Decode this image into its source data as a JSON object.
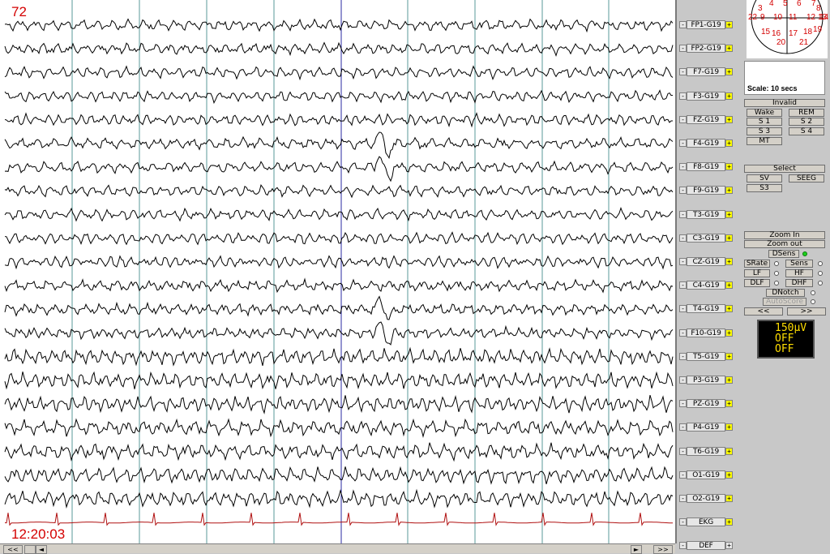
{
  "page_number": "72",
  "timestamp": "12:20:03",
  "channels": [
    {
      "label": "FP1-G19"
    },
    {
      "label": "FP2-G19"
    },
    {
      "label": "F7-G19"
    },
    {
      "label": "F3-G19"
    },
    {
      "label": "FZ-G19"
    },
    {
      "label": "F4-G19"
    },
    {
      "label": "F8-G19"
    },
    {
      "label": "F9-G19"
    },
    {
      "label": "T3-G19"
    },
    {
      "label": "C3-G19"
    },
    {
      "label": "CZ-G19"
    },
    {
      "label": "C4-G19"
    },
    {
      "label": "T4-G19"
    },
    {
      "label": "F10-G19"
    },
    {
      "label": "T5-G19"
    },
    {
      "label": "P3-G19"
    },
    {
      "label": "PZ-G19"
    },
    {
      "label": "P4-G19"
    },
    {
      "label": "T6-G19"
    },
    {
      "label": "O1-G19"
    },
    {
      "label": "O2-G19"
    },
    {
      "label": "EKG",
      "ekg": true
    },
    {
      "label": "DEF"
    }
  ],
  "channel_buttons": {
    "minus": "-",
    "plus": "+"
  },
  "trace_color": "#000000",
  "ekg_color": "#b01010",
  "electrodes": [
    "4",
    "5",
    "6",
    "7",
    "3",
    "8",
    "12",
    "13",
    "14",
    "22",
    "9",
    "10",
    "11",
    "15",
    "16",
    "17",
    "18",
    "19",
    "20",
    "21"
  ],
  "scale_label": "Scale: 10 secs",
  "buttons": {
    "invalid": "Invalid",
    "wake": "Wake",
    "rem": "REM",
    "s1": "S 1",
    "s2": "S 2",
    "s3": "S 3",
    "s4": "S 4",
    "mt": "MT",
    "select": "Select",
    "sv": "SV",
    "seeg": "SEEG",
    "s3b": "S3",
    "zoom_in": "Zoom In",
    "zoom_out": "Zoom out",
    "dsens": "DSens",
    "srate": "SRate",
    "sens": "Sens",
    "lf": "LF",
    "hf": "HF",
    "dlf": "DLF",
    "dhf": "DHF",
    "dnotch": "DNotch",
    "autoscore": "AutoScore",
    "prev": "<<",
    "next": ">>"
  },
  "lcd": {
    "sensitivity": "150µV",
    "line2": "OFF",
    "line3": "OFF"
  },
  "scrollbar": {
    "left": "<<",
    "left_small": "◄",
    "right_small": "►",
    "right": ">>"
  }
}
